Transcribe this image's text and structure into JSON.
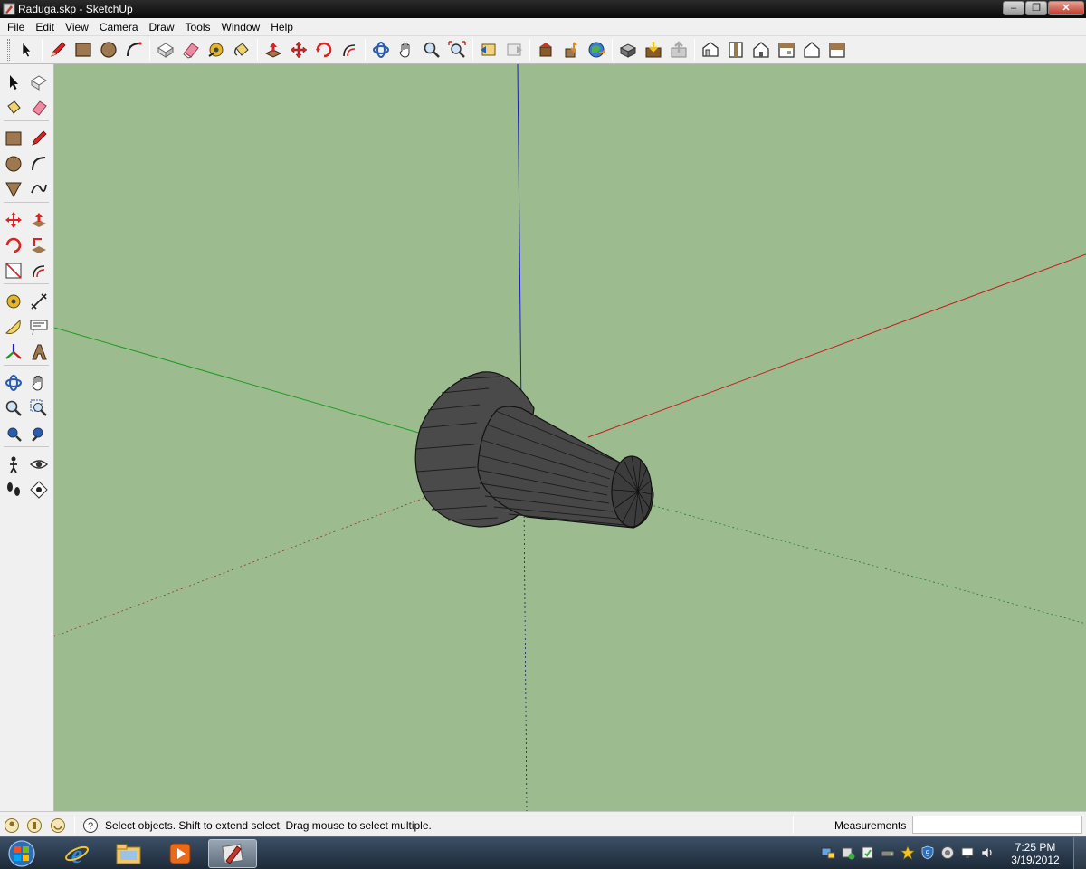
{
  "window": {
    "title": "Raduga.skp - SketchUp",
    "minimize_glyph": "–",
    "maximize_glyph": "❐",
    "close_glyph": "✕"
  },
  "menu": {
    "items": [
      "File",
      "Edit",
      "View",
      "Camera",
      "Draw",
      "Tools",
      "Window",
      "Help"
    ]
  },
  "toolbar": {
    "icons": [
      "select-icon",
      "pencil-icon",
      "rectangle-icon",
      "circle-icon",
      "arc-icon",
      "make-component-icon",
      "eraser-icon",
      "tape-measure-icon",
      "paint-bucket-icon",
      "push-pull-icon",
      "move-icon",
      "rotate-icon",
      "offset-icon",
      "orbit-icon",
      "pan-icon",
      "zoom-icon",
      "zoom-extents-icon",
      "previous-view-icon",
      "next-view-icon",
      "get-models-icon",
      "share-model-icon",
      "share-component-icon",
      "get-photo-texture-icon",
      "iso-view-icon",
      "top-view-icon",
      "front-view-icon",
      "right-view-icon",
      "back-view-icon",
      "left-view-icon"
    ]
  },
  "statusbar": {
    "message": "Select objects. Shift to extend select. Drag mouse to select multiple.",
    "measurements_label": "Measurements",
    "measurements_value": ""
  },
  "taskbar": {
    "time": "7:25 PM",
    "date": "3/19/2012"
  },
  "colors": {
    "viewport_bg": "#9cbc8f",
    "model_fill": "#4a4a4a",
    "axis_red": "#c41e1e",
    "axis_green": "#1f9a1f",
    "axis_blue": "#1a1acc"
  }
}
